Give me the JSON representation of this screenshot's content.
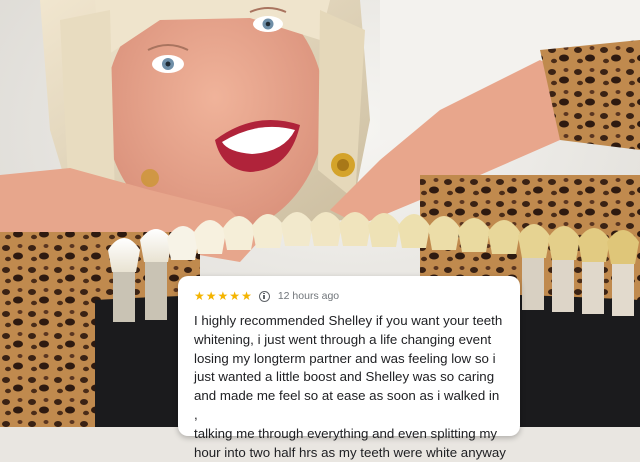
{
  "review": {
    "rating": 5,
    "time": "12 hours ago",
    "text": "I highly recommended Shelley if you want your teeth\nwhitening, i just went through a life changing event\nlosing my longterm partner and was feeling low so i\njust wanted a little boost and Shelley was so caring\nand made me feel so at ease as soon as i walked in ,\ntalking me through everything and even splitting my\nhour into two half hrs as my teeth were white anyway"
  },
  "colors": {
    "star": "#f4b400",
    "card": "#ffffff",
    "text": "#202124"
  }
}
